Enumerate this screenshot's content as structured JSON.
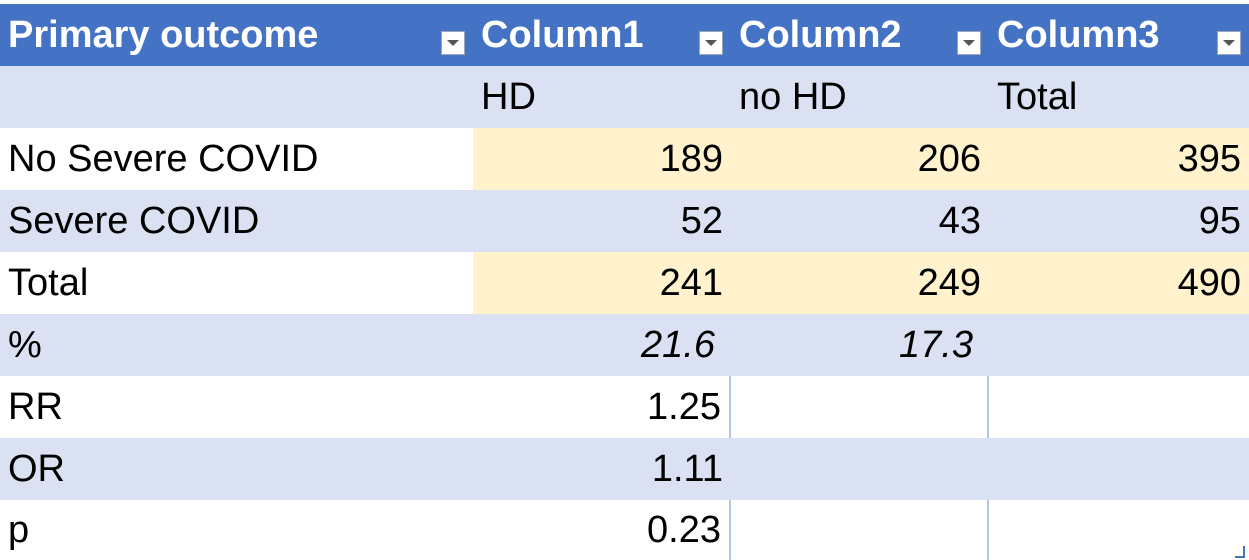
{
  "table": {
    "columns": [
      {
        "label": "Primary outcome"
      },
      {
        "label": "Column1"
      },
      {
        "label": "Column2"
      },
      {
        "label": "Column3"
      }
    ],
    "rows": [
      {
        "cells": [
          "",
          "HD",
          "no HD",
          "Total"
        ]
      },
      {
        "cells": [
          "No Severe COVID",
          "189",
          "206",
          "395"
        ]
      },
      {
        "cells": [
          "Severe COVID",
          "52",
          "43",
          "95"
        ]
      },
      {
        "cells": [
          "Total",
          "241",
          "249",
          "490"
        ]
      },
      {
        "cells": [
          "%",
          "21.6",
          "17.3",
          ""
        ]
      },
      {
        "cells": [
          "RR",
          "1.25",
          "",
          ""
        ]
      },
      {
        "cells": [
          "OR",
          "1.11",
          "",
          ""
        ]
      },
      {
        "cells": [
          "p",
          "0.23",
          "",
          ""
        ]
      }
    ]
  },
  "colors": {
    "header": "#4472c4",
    "band": "#d9e1f2",
    "highlight": "#fff2cc",
    "border": "#8eaadb"
  },
  "icons": {
    "filter": "chevron-down-icon",
    "resize": "resize-handle-icon"
  }
}
